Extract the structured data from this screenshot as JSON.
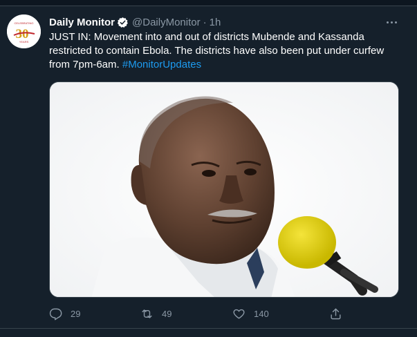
{
  "tweet": {
    "display_name": "Daily Monitor",
    "handle": "@DailyMonitor",
    "separator": "·",
    "time": "1h",
    "text_lines": [
      "JUST IN: Movement into and out of districts Mubende and Kassanda",
      "restricted to contain Ebola. The districts have also been put under curfew",
      "from 7pm-6am. "
    ],
    "hashtag": "#MonitorUpdates",
    "avatar": {
      "logo_text": "30",
      "top_text": "CELEBRATING",
      "bottom_text": "YEARS"
    }
  },
  "actions": {
    "reply_count": "29",
    "retweet_count": "49",
    "like_count": "140"
  },
  "icons": {
    "verified": "verified-badge-icon",
    "more": "more-options-icon",
    "reply": "reply-icon",
    "retweet": "retweet-icon",
    "like": "heart-icon",
    "share": "share-icon"
  },
  "colors": {
    "background": "#15202b",
    "text": "#ffffff",
    "secondary_text": "#8b98a5",
    "link": "#1d9bf0",
    "border": "#38444d"
  }
}
